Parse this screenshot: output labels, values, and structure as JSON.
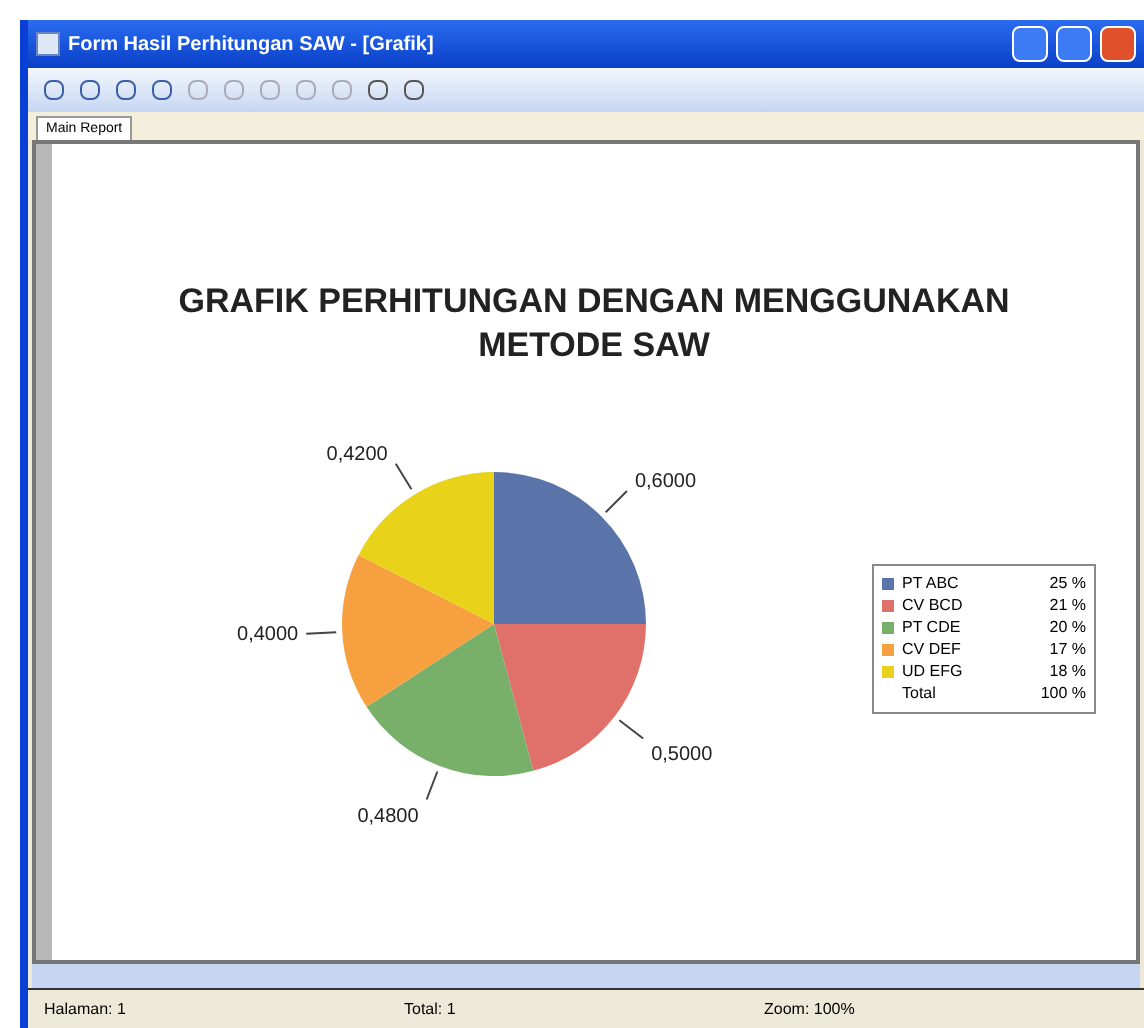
{
  "window": {
    "title": "Form Hasil Perhitungan SAW - [Grafik]"
  },
  "tabs": [
    {
      "label": "Main Report",
      "selected": true
    }
  ],
  "chart": {
    "title": "GRAFIK PERHITUNGAN DENGAN MENGGUNAKAN METODE SAW",
    "chart_data": {
      "type": "pie",
      "categories": [
        "PT ABC",
        "CV BCD",
        "PT CDE",
        "CV DEF",
        "UD EFG"
      ],
      "values": [
        0.6,
        0.5,
        0.48,
        0.4,
        0.42
      ],
      "value_labels": [
        "0,6000",
        "0,5000",
        "0,4800",
        "0,4000",
        "0,4200"
      ],
      "colors": [
        "#5a73a8",
        "#e0706a",
        "#78b06a",
        "#f7a040",
        "#e8d21a"
      ]
    },
    "legend": [
      {
        "value": "25 %"
      },
      {
        "value": "21 %"
      },
      {
        "value": "20 %"
      },
      {
        "value": "17 %"
      },
      {
        "value": "18 %"
      }
    ],
    "total": {
      "label": "Total",
      "value": "100 %"
    }
  },
  "status_bar": [
    "Halaman: 1",
    "Total: 1",
    "Zoom: 100%"
  ]
}
